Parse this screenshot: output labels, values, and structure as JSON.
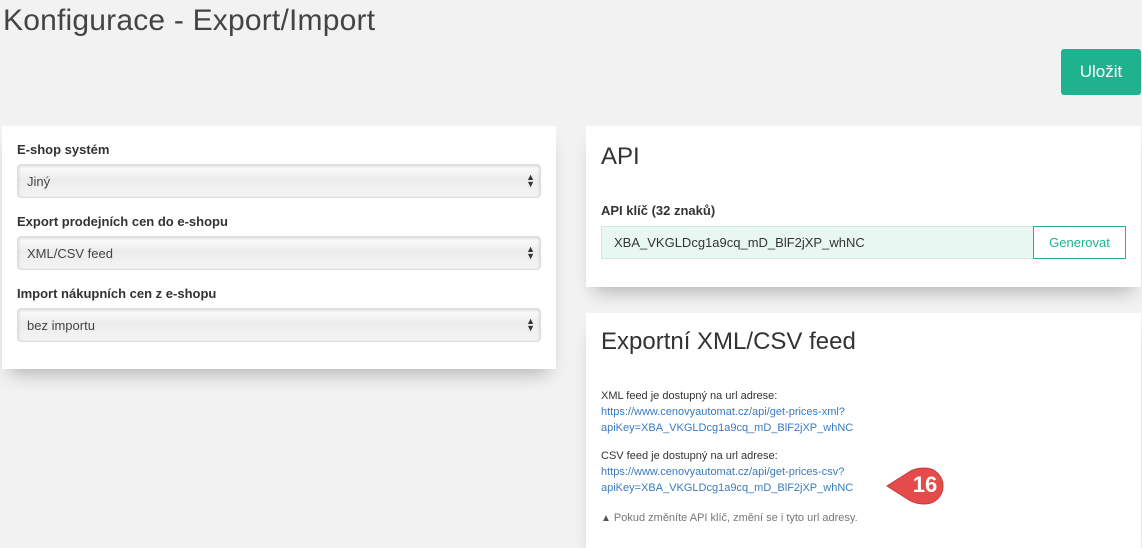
{
  "page": {
    "title": "Konfigurace - Export/Import"
  },
  "toolbar": {
    "save_label": "Uložit"
  },
  "eshop": {
    "fields": [
      {
        "label": "E-shop systém",
        "value": "Jiný"
      },
      {
        "label": "Export prodejních cen do e-shopu",
        "value": "XML/CSV feed"
      },
      {
        "label": "Import nákupních cen z e-shopu",
        "value": "bez importu"
      }
    ]
  },
  "api": {
    "title": "API",
    "key_label": "API klíč (32 znaků)",
    "key_value": "XBA_VKGLDcg1a9cq_mD_BlF2jXP_whNC",
    "generate_label": "Generovat"
  },
  "feed": {
    "title": "Exportní XML/CSV feed",
    "xml_text": "XML feed je dostupný na url adrese:",
    "xml_url_1": "https://www.cenovyautomat.cz/api/get-prices-xml?",
    "xml_url_2": "apiKey=XBA_VKGLDcg1a9cq_mD_BlF2jXP_whNC",
    "csv_text": "CSV feed je dostupný na url adrese:",
    "csv_url_1": "https://www.cenovyautomat.cz/api/get-prices-csv?",
    "csv_url_2": "apiKey=XBA_VKGLDcg1a9cq_mD_BlF2jXP_whNC",
    "note": "Pokud změníte API klíč, změní se i tyto url adresy."
  },
  "badge": {
    "number": "16",
    "color": "#e64b4b"
  },
  "colors": {
    "accent": "#1fb28f",
    "link": "#3a7bbf"
  }
}
